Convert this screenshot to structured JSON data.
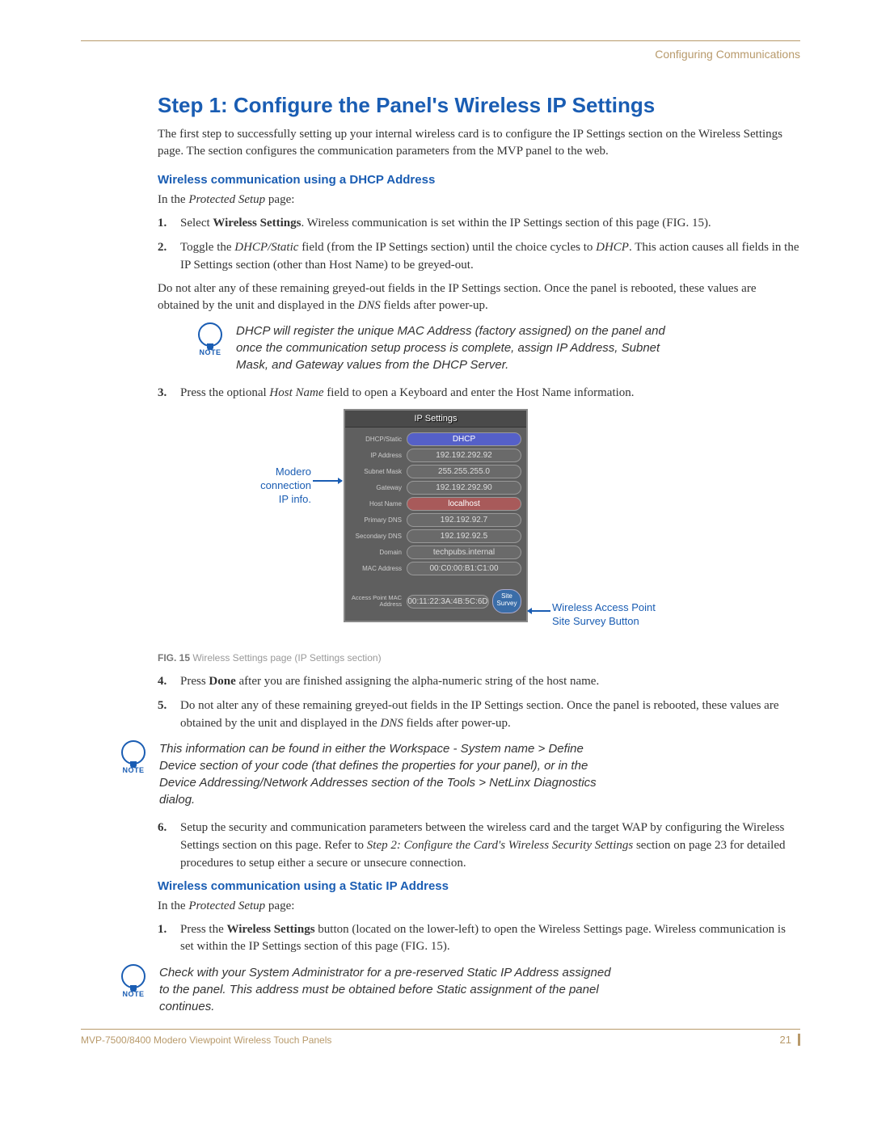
{
  "header": "Configuring Communications",
  "title": "Step 1: Configure the Panel's Wireless IP Settings",
  "intro": "The first step to successfully setting up your internal wireless card is to configure the IP Settings section on the Wireless Settings page. The section configures the communication parameters from the MVP panel to the web.",
  "section_dhcp": {
    "heading": "Wireless communication using a DHCP Address",
    "lead_prefix": "In the ",
    "lead_em": "Protected Setup",
    "lead_suffix": " page:",
    "step1_a": "Select ",
    "step1_b": "Wireless Settings",
    "step1_c": ". Wireless communication is set within the IP Settings section of this page (FIG. 15).",
    "step2_a": "Toggle the ",
    "step2_b": "DHCP/Static",
    "step2_c": " field (from the IP Settings section) until the choice cycles to ",
    "step2_d": "DHCP",
    "step2_e": ". This action causes all fields in the IP Settings section (other than Host Name) to be greyed-out.",
    "post2_a": "Do not alter any of these remaining greyed-out fields in the IP Settings section. Once the panel is rebooted, these values are obtained by the unit and displayed in the ",
    "post2_b": "DNS",
    "post2_c": " fields after power-up.",
    "note1": "DHCP will register the unique MAC Address (factory assigned) on the panel and once the communication setup process is complete, assign IP Address, Subnet Mask, and Gateway values from the DHCP Server.",
    "step3_a": "Press the optional ",
    "step3_b": "Host Name",
    "step3_c": " field to open a Keyboard and enter the Host Name information.",
    "step4_a": "Press ",
    "step4_b": "Done",
    "step4_c": " after you are finished assigning the alpha-numeric string of the host name.",
    "step5_a": "Do not alter any of these remaining greyed-out fields in the IP Settings section. Once the panel is rebooted, these values are obtained by the unit and displayed in the ",
    "step5_b": "DNS",
    "step5_c": " fields after power-up.",
    "note2": "This information can be found in either the Workspace - System name > Define Device section of your code (that defines the properties for your panel), or in the Device Addressing/Network Addresses section of the Tools > NetLinx Diagnostics dialog.",
    "step6_a": "Setup the security and communication parameters between the wireless card and the target WAP by configuring the Wireless Settings section on this page. Refer to ",
    "step6_b": "Step 2: Configure the Card's Wireless Security Settings",
    "step6_c": " section on page 23 for detailed procedures to setup either a secure or unsecure connection."
  },
  "section_static": {
    "heading": "Wireless communication using a Static IP Address",
    "lead_prefix": "In the ",
    "lead_em": "Protected Setup",
    "lead_suffix": " page:",
    "step1_a": "Press the ",
    "step1_b": "Wireless Settings",
    "step1_c": " button (located on the lower-left) to open the Wireless Settings page. Wireless communication is set within the IP Settings section of this page (FIG. 15).",
    "note3": "Check with your System Administrator for a pre-reserved Static IP Address assigned to the panel. This address must be obtained before Static assignment of the panel continues."
  },
  "note_label": "NOTE",
  "figure": {
    "panel_title": "IP Settings",
    "rows": {
      "dhcp_static": {
        "label": "DHCP/Static",
        "value": "DHCP"
      },
      "ip_address": {
        "label": "IP Address",
        "value": "192.192.292.92"
      },
      "subnet": {
        "label": "Subnet Mask",
        "value": "255.255.255.0"
      },
      "gateway": {
        "label": "Gateway",
        "value": "192.192.292.90"
      },
      "hostname": {
        "label": "Host Name",
        "value": "localhost"
      },
      "pri_dns": {
        "label": "Primary DNS",
        "value": "192.192.92.7"
      },
      "sec_dns": {
        "label": "Secondary DNS",
        "value": "192.192.92.5"
      },
      "domain": {
        "label": "Domain",
        "value": "techpubs.internal"
      },
      "mac": {
        "label": "MAC Address",
        "value": "00:C0:00:B1:C1:00"
      },
      "ap_mac": {
        "label": "Access Point MAC Address",
        "value": "00:11:22:3A:4B:5C:6D"
      }
    },
    "site_survey": "Site Survey",
    "callout_left_l1": "Modero",
    "callout_left_l2": "connection",
    "callout_left_l3": "IP info.",
    "callout_right_l1": "Wireless Access Point",
    "callout_right_l2": "Site Survey Button",
    "caption_b": "FIG. 15",
    "caption_rest": "  Wireless Settings page (IP Settings section)"
  },
  "footer": {
    "text": "MVP-7500/8400 Modero Viewpoint Wireless Touch Panels",
    "page": "21"
  }
}
